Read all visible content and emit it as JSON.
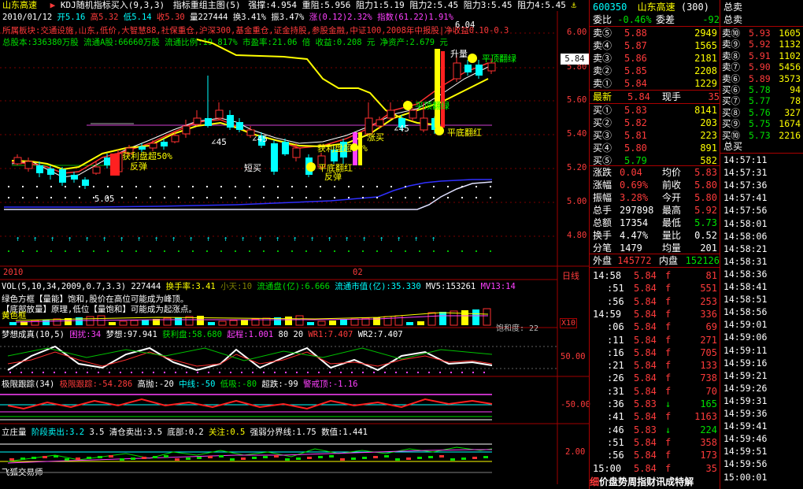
{
  "header": {
    "stock_name": "山东高速",
    "indicator_title": "KDJ随机指标买入(9,3,3)",
    "main_chart_title": "指标重组主图(5)",
    "qiangcheng": "强撑:4.954",
    "chongzu": "重阻:5.956",
    "zuli1": "阻力1:5.19",
    "zuli2": "阻力2:5.45",
    "zuli3": "阻力3:5.45",
    "zuli4": "阻力4:5.45"
  },
  "ohlc_bar": {
    "date": "2010/01/12",
    "open": "开5.16",
    "high": "高5.32",
    "low": "低5.14",
    "close": "收5.30",
    "volume": "量227444",
    "turnover": "换3.41%",
    "amplitude": "振3.47%",
    "change": "涨(0.12)2.32%",
    "index": "指数(61.22)1.91%"
  },
  "info_lines": {
    "sector": "所属板块:交通设施,山东,低价,大智慧88,社保重仓,沪深300,基金重仓,证金持股,参股金融,中证100,2008年中报股|净收益0.10-0.3",
    "equity": "总股本:336380万股   流通A股:66660万股   流通比例:19.817%   市盈率:21.06 倍   收益:0.208 元   净资产:2.679 元"
  },
  "chart_annotations": {
    "label_504": "6.04",
    "label_505": "5.05",
    "shenglingshou": "升量",
    "ping_top_turn_green": "平顶翻绿",
    "ping_top_sell_green_top": "平顶翻绿",
    "ping_bottom_turn_red": "平底翻红",
    "ping_bottom_turn_red2": "平底翻红",
    "ping_top_sell": "平顶翻绿",
    "shenglu": "获利盘超50%",
    "shenglu2": "获利盘超50%",
    "fantan1": "反弹",
    "fantan2": "反弹",
    "duanmai": "短买",
    "ang45a": "∠45",
    "ang45b": "∠45",
    "ang45c": "∠45",
    "zhangmai": "涨买"
  },
  "price_axis": {
    "ticks": [
      "6.00",
      "5.80",
      "5.60",
      "5.40",
      "5.20",
      "5.00",
      "4.80"
    ],
    "current": "5.84"
  },
  "x_axis": {
    "labels": [
      "2010",
      "02"
    ],
    "right_label": "日线"
  },
  "volume_panel": {
    "title": "VOL(5,10,34,2009,0.7,3.3)",
    "vol_value": "227444",
    "huanshou": "换手率:3.41",
    "xiaotian": "小天:10",
    "ltp": "流通盘(亿):6.666",
    "ltsz": "流通市值(亿):35.330",
    "mv5": "MV5:153261",
    "mv13": "MV13:14",
    "note1": "绿色方框【量能】饱和,股价在高位可能成为峰顶。",
    "note2": "【底部放量】原理,低位【量饱和】可能成为起涨点。",
    "note3": "黄色框",
    "note_tail": "饱和度: 22",
    "scale": "X10"
  },
  "mxcj_panel": {
    "title": "梦想成真(10,5)",
    "kunrao": "困扰:34",
    "mengxiang": "梦想:97.941",
    "huolipan": "获利盘:58.680",
    "qiqi": "起程:1.001",
    "v80": "80",
    "v20": "20",
    "wr1": "WR1:7.407",
    "wr2": "WR2:7.407",
    "axis_label": "50.00"
  },
  "jxgz_panel": {
    "title": "极限跟踪(34)",
    "jxgz": "极限跟踪:-54.286",
    "gaochao": "高抛:-20",
    "zhongxian": "中线:-50",
    "dixi": "低吸:-80",
    "chaodie": "超跌:-99",
    "jingjie": "警戒顶:-1.16",
    "axis_label": "-50.00"
  },
  "lzl_panel": {
    "title": "立庄量",
    "jieduan": "阶段卖出:3.2",
    "v35": "3.5",
    "qingcang": "清仓卖出:3.5",
    "dibu": "底部:0.2",
    "guanzhu": "关注:0.5",
    "qiangruo": "强弱分界线:1.75",
    "shuzhi": "数值:1.441",
    "axis_label": "2.00",
    "footer": "飞狐交易师"
  },
  "quote": {
    "code": "600350",
    "name": "山东高速",
    "code_tag": "(300)",
    "weibi_label": "委比",
    "weibi_value": "-0.46%",
    "weicha_label": "委差",
    "weicha_value": "-92",
    "sells": [
      {
        "label": "卖⑤",
        "price": "5.88",
        "vol": "2949"
      },
      {
        "label": "卖④",
        "price": "5.87",
        "vol": "1565"
      },
      {
        "label": "卖③",
        "price": "5.86",
        "vol": "2181"
      },
      {
        "label": "卖②",
        "price": "5.85",
        "vol": "2208"
      },
      {
        "label": "卖①",
        "price": "5.84",
        "vol": "1229"
      }
    ],
    "last_label": "最新",
    "last_price": "5.84",
    "xianshou_label": "现手",
    "xianshou_value": "35",
    "buys": [
      {
        "label": "买①",
        "price": "5.83",
        "vol": "8141"
      },
      {
        "label": "买②",
        "price": "5.82",
        "vol": "203"
      },
      {
        "label": "买③",
        "price": "5.81",
        "vol": "223"
      },
      {
        "label": "买④",
        "price": "5.80",
        "vol": "891"
      },
      {
        "label": "买⑤",
        "price": "5.79",
        "vol": "582"
      }
    ],
    "stats": [
      {
        "l1": "涨跌",
        "v1": "0.04",
        "l2": "均价",
        "v2": "5.83"
      },
      {
        "l1": "涨幅",
        "v1": "0.69%",
        "l2": "前收",
        "v2": "5.80"
      },
      {
        "l1": "振幅",
        "v1": "3.28%",
        "l2": "今开",
        "v2": "5.80"
      },
      {
        "l1": "总手",
        "v1": "297898",
        "l2": "最高",
        "v2": "5.92"
      },
      {
        "l1": "总额",
        "v1": "17354",
        "l2": "最低",
        "v2": "5.73"
      },
      {
        "l1": "换手",
        "v1": "4.47%",
        "l2": "量比",
        "v2": "0.52"
      },
      {
        "l1": "分笔",
        "v1": "1479",
        "l2": "均量",
        "v2": "201"
      }
    ],
    "waipan_label": "外盘",
    "waipan_value": "145772",
    "neipan_label": "内盘",
    "neipan_value": "152126",
    "ticks": [
      {
        "t": "14:58",
        "p": "5.84",
        "f": "f",
        "v": "81"
      },
      {
        "t": ":51",
        "p": "5.84",
        "f": "f",
        "v": "551"
      },
      {
        "t": ":56",
        "p": "5.84",
        "f": "f",
        "v": "253"
      },
      {
        "t": "14:59",
        "p": "5.84",
        "f": "f",
        "v": "336"
      },
      {
        "t": ":06",
        "p": "5.84",
        "f": "f",
        "v": "69"
      },
      {
        "t": ":11",
        "p": "5.84",
        "f": "f",
        "v": "271"
      },
      {
        "t": ":16",
        "p": "5.84",
        "f": "f",
        "v": "705"
      },
      {
        "t": ":21",
        "p": "5.84",
        "f": "f",
        "v": "133"
      },
      {
        "t": ":26",
        "p": "5.84",
        "f": "f",
        "v": "738"
      },
      {
        "t": ":31",
        "p": "5.84",
        "f": "f",
        "v": "70"
      },
      {
        "t": ":36",
        "p": "5.83",
        "f": "↓",
        "v": "165"
      },
      {
        "t": ":41",
        "p": "5.84",
        "f": "f",
        "v": "1163"
      },
      {
        "t": ":46",
        "p": "5.83",
        "f": "↓",
        "v": "224"
      },
      {
        "t": ":51",
        "p": "5.84",
        "f": "f",
        "v": "358"
      },
      {
        "t": ":56",
        "p": "5.84",
        "f": "f",
        "v": "173"
      },
      {
        "t": "15:00",
        "p": "5.84",
        "f": "f",
        "v": "35"
      }
    ],
    "bottom_tabs": [
      "细",
      "价",
      "盘",
      "势",
      "周",
      "指",
      "财",
      "讯",
      "成",
      "特",
      "解"
    ]
  },
  "total_sell": {
    "header": "总卖",
    "rows": [
      {
        "label": "卖⑩",
        "price": "5.93",
        "vol": "1605"
      },
      {
        "label": "卖⑨",
        "price": "5.92",
        "vol": "1132"
      },
      {
        "label": "卖⑧",
        "price": "5.91",
        "vol": "1102"
      },
      {
        "label": "卖⑦",
        "price": "5.90",
        "vol": "5456"
      },
      {
        "label": "卖⑥",
        "price": "5.89",
        "vol": "3573"
      },
      {
        "label": "买⑥",
        "price": "5.78",
        "vol": "94"
      },
      {
        "label": "买⑦",
        "price": "5.77",
        "vol": "78"
      },
      {
        "label": "买⑧",
        "price": "5.76",
        "vol": "327"
      },
      {
        "label": "买⑨",
        "price": "5.75",
        "vol": "1674"
      },
      {
        "label": "买⑩",
        "price": "5.73",
        "vol": "2216"
      }
    ],
    "total_buy_label": "总买",
    "times": [
      "14:57:11",
      "14:57:31",
      "14:57:36",
      "14:57:41",
      "14:57:56",
      "14:58:01",
      "14:58:06",
      "14:58:21",
      "14:58:31",
      "14:58:36",
      "14:58:41",
      "14:58:51",
      "14:58:56",
      "14:59:01",
      "14:59:06",
      "14:59:11",
      "14:59:16",
      "14:59:21",
      "14:59:26",
      "14:59:31",
      "14:59:36",
      "14:59:41",
      "14:59:46",
      "14:59:51",
      "14:59:56",
      "15:00:01"
    ]
  },
  "colors": {
    "up": "#ff3b3b",
    "down": "#00ffff",
    "grid": "#a00000",
    "accent": "#ffff00"
  }
}
